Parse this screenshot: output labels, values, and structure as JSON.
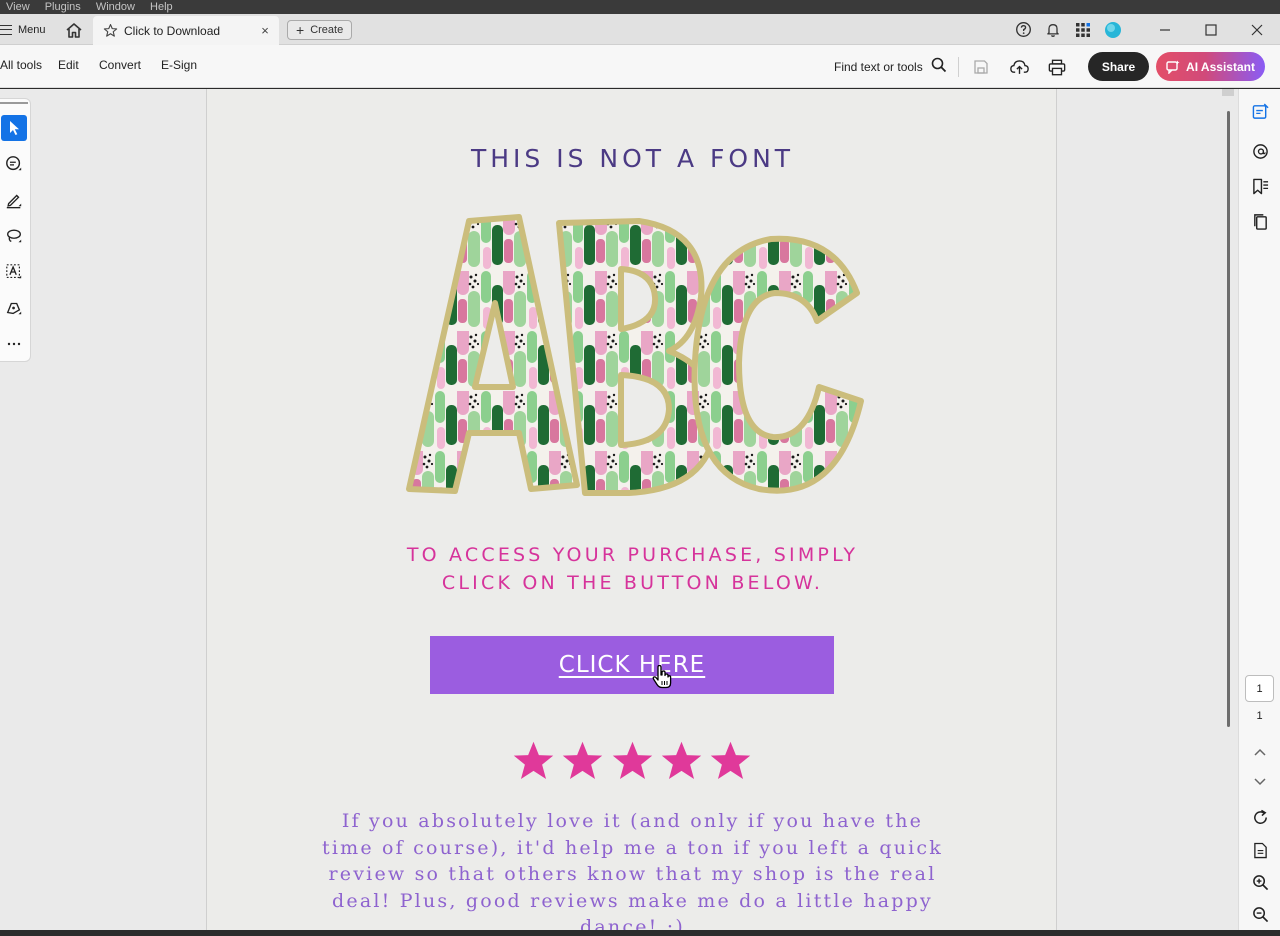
{
  "os_menu": [
    "View",
    "Plugins",
    "Window",
    "Help"
  ],
  "tabbar": {
    "menu_label": "Menu",
    "tab_title": "Click to Download",
    "tab_close": "×",
    "create_label": "Create"
  },
  "toolbar": {
    "items": [
      "All tools",
      "Edit",
      "Convert",
      "E-Sign"
    ],
    "find_label": "Find text or tools",
    "share_label": "Share",
    "ai_label": "AI Assistant"
  },
  "document": {
    "headline": "THIS IS NOT A FONT",
    "art_letters": "ABC",
    "access_line1": "TO ACCESS YOUR PURCHASE, SIMPLY",
    "access_line2": "CLICK ON THE BUTTON BELOW.",
    "cta_label": "CLICK HERE",
    "rating": 5,
    "review_lines": [
      "If you absolutely love it (and only if you have the",
      "time of course), it'd help me a ton if you left a quick",
      "review so that others know that my shop is the real",
      "deal! Plus, good reviews make me do a little happy",
      "dance! :)"
    ]
  },
  "pagination": {
    "current": "1",
    "total": "1"
  },
  "colors": {
    "headline": "#4b3a84",
    "access_text": "#d6339b",
    "cta_background": "#9b5de0",
    "stars": "#e0399a",
    "review_text": "#8e63cf",
    "accent_blue": "#1473e6"
  }
}
